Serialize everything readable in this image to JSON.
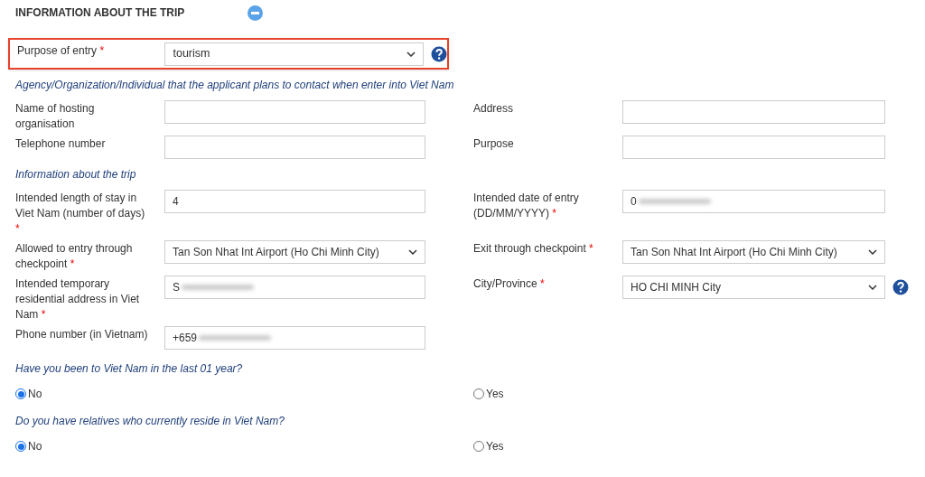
{
  "header": {
    "title": "INFORMATION ABOUT THE TRIP",
    "collapsed": false
  },
  "purpose": {
    "label": "Purpose of entry",
    "required_mark": "*",
    "value": "tourism",
    "highlighted": true
  },
  "sections": [
    {
      "title": "Agency/Organization/Individual that the applicant plans to contact when enter into Viet Nam",
      "rows": [
        [
          {
            "label": "Name of hosting organisation",
            "kind": "text"
          },
          {
            "label": "Address",
            "kind": "text"
          }
        ],
        [
          {
            "label": "Telephone number",
            "kind": "text"
          },
          {
            "label": "Purpose",
            "kind": "text"
          }
        ]
      ]
    },
    {
      "title": "Information about the trip",
      "rows": [
        [
          {
            "label": "Intended length of stay in Viet Nam (number of days)",
            "required_mark": "*",
            "kind": "text",
            "value": "4"
          },
          {
            "label": "Intended date of entry (DD/MM/YYYY)",
            "required_mark": "*",
            "kind": "text",
            "value": "0",
            "blurred": true
          }
        ],
        [
          {
            "label": "Allowed to entry through checkpoint",
            "required_mark": "*",
            "kind": "select",
            "value": "Tan Son Nhat Int Airport (Ho Chi Minh City)"
          },
          {
            "label": "Exit through checkpoint",
            "required_mark": "*",
            "kind": "select",
            "value": "Tan Son Nhat Int Airport (Ho Chi Minh City)"
          }
        ],
        [
          {
            "label": "Intended temporary residential address in Viet Nam",
            "required_mark": "*",
            "kind": "text",
            "value": "S",
            "blurred": true
          },
          {
            "label": "City/Province",
            "required_mark": "*",
            "kind": "select",
            "value": "HO CHI MINH City",
            "help": true
          }
        ],
        [
          {
            "label": "Phone number (in Vietnam)",
            "kind": "text",
            "value": "+659",
            "blurred": true
          }
        ]
      ]
    }
  ],
  "questions": [
    {
      "text": "Have you been to Viet Nam in the last 01 year?",
      "options": [
        {
          "label": "No",
          "selected": true
        },
        {
          "label": "Yes",
          "selected": false
        }
      ]
    },
    {
      "text": "Do you have relatives who currently reside in Viet Nam?",
      "options": [
        {
          "label": "No",
          "selected": true
        },
        {
          "label": "Yes",
          "selected": false
        }
      ]
    }
  ]
}
